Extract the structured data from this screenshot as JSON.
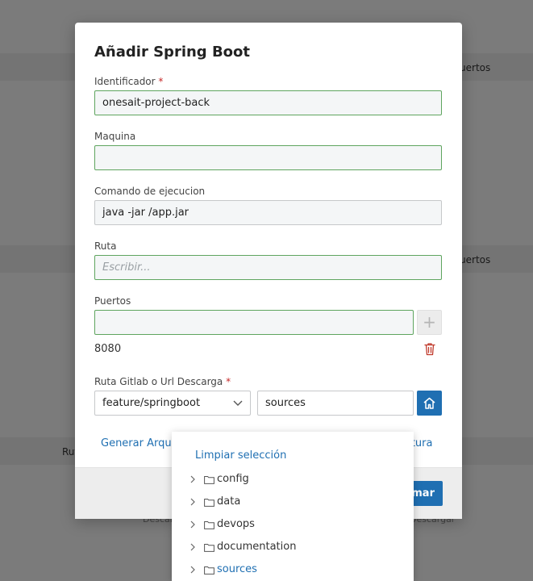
{
  "background": {
    "header_puertos_1": "Puertos",
    "header_puertos_2": "Puertos",
    "row_ruta": "Ruta",
    "faded_left": "Descargar",
    "faded_right": "Descargar"
  },
  "modal": {
    "title": "Añadir Spring Boot",
    "fields": {
      "identificador": {
        "label": "Identificador",
        "required": "*",
        "value": "onesait-project-back"
      },
      "maquina": {
        "label": "Maquina",
        "value": ""
      },
      "comando": {
        "label": "Comando de ejecucion",
        "value": "java -jar /app.jar"
      },
      "ruta": {
        "label": "Ruta",
        "placeholder": "Escribir..."
      },
      "puertos": {
        "label": "Puertos",
        "value": "",
        "add_symbol": "+",
        "items": [
          "8080"
        ]
      },
      "gitlab": {
        "label": "Ruta Gitlab o Url Descarga",
        "required": "*",
        "branch": "feature/springboot",
        "path": "sources"
      }
    },
    "links": {
      "generar": "Generar Arquetipo",
      "estructura": "Estructura"
    },
    "footer": {
      "confirm": "Confirmar"
    }
  },
  "tree_dropdown": {
    "clear_label": "Limpiar selección",
    "items": [
      {
        "name": "config",
        "active": false
      },
      {
        "name": "data",
        "active": false
      },
      {
        "name": "devops",
        "active": false
      },
      {
        "name": "documentation",
        "active": false
      },
      {
        "name": "sources",
        "active": true
      }
    ]
  },
  "colors": {
    "accent": "#1f6fb2",
    "valid_border": "#5fa55f",
    "required": "#c62828",
    "trash": "#c0392b"
  }
}
